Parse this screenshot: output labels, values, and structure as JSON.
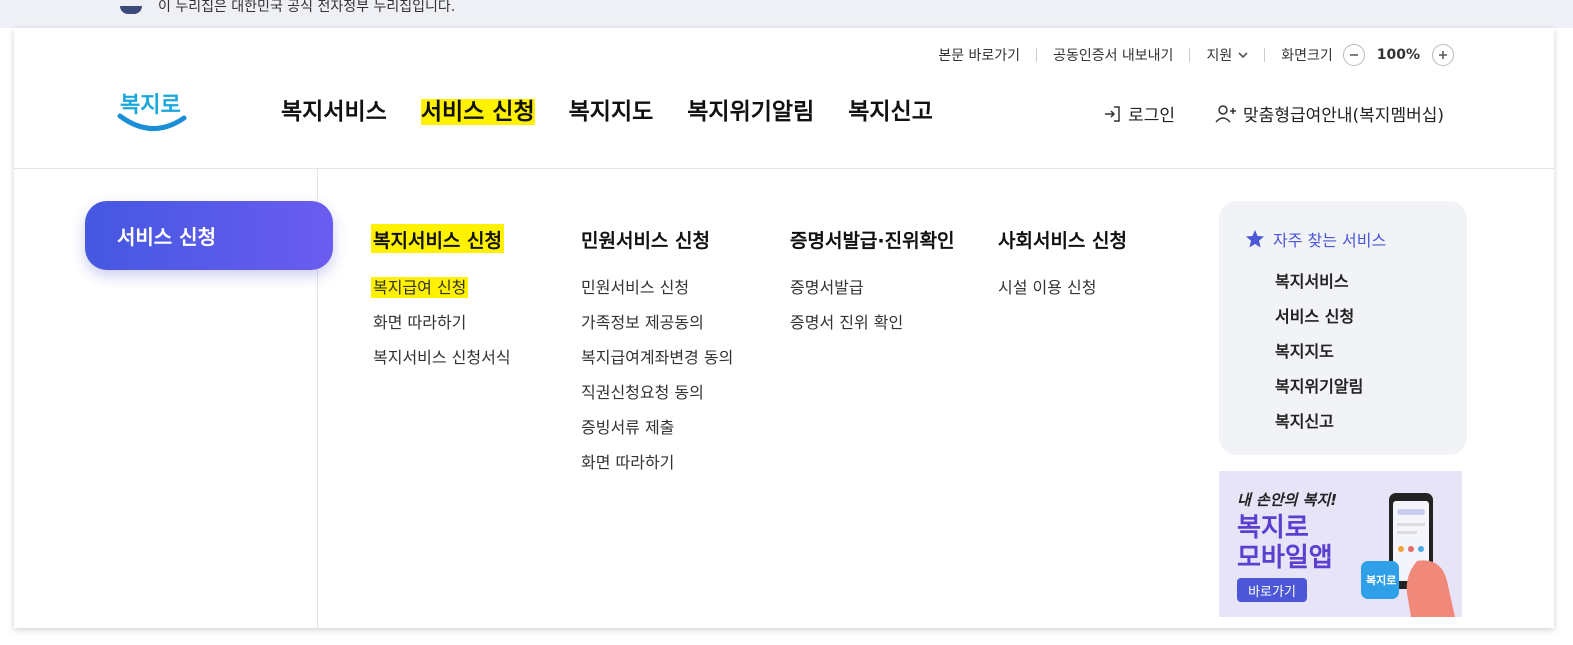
{
  "gov_notice": "이 누리집은 대한민국 공식 전자정부 누리집입니다.",
  "utility": {
    "skip_to_content": "본문 바로가기",
    "cert_export": "공동인증서 내보내기",
    "support": "지원",
    "screen_size_label": "화면크기",
    "zoom_value": "100%",
    "zoom_out_icon": "minus-icon",
    "zoom_in_icon": "plus-icon"
  },
  "logo": {
    "text": "복지로"
  },
  "gnb": {
    "items": [
      {
        "label": "복지서비스"
      },
      {
        "label": "서비스 신청"
      },
      {
        "label": "복지지도"
      },
      {
        "label": "복지위기알림"
      },
      {
        "label": "복지신고"
      }
    ]
  },
  "account": {
    "login": "로그인",
    "membership": "맞춤형급여안내(복지멤버십)"
  },
  "section": {
    "title": "서비스 신청"
  },
  "menus": [
    {
      "title": "복지서비스 신청",
      "items": [
        "복지급여 신청",
        "화면 따라하기",
        "복지서비스 신청서식"
      ]
    },
    {
      "title": "민원서비스 신청",
      "items": [
        "민원서비스 신청",
        "가족정보 제공동의",
        "복지급여계좌변경 동의",
        "직권신청요청 동의",
        "증빙서류 제출",
        "화면 따라하기"
      ]
    },
    {
      "title": "증명서발급·진위확인",
      "items": [
        "증명서발급",
        "증명서 진위 확인"
      ]
    },
    {
      "title": "사회서비스 신청",
      "items": [
        "시설 이용 신청"
      ]
    }
  ],
  "favorites": {
    "title": "자주 찾는 서비스",
    "icon": "star-icon",
    "items": [
      "복지서비스",
      "서비스 신청",
      "복지지도",
      "복지위기알림",
      "복지신고"
    ]
  },
  "banner": {
    "small": "내 손안의 복지!",
    "line1": "복지로",
    "line2": "모바일앱",
    "button": "바로가기",
    "logo_text": "복지로"
  },
  "colors": {
    "highlight": "#fff200",
    "accent": "#4b57d6",
    "pill_gradient_start": "#4458e0",
    "pill_gradient_end": "#6b5cf0"
  }
}
